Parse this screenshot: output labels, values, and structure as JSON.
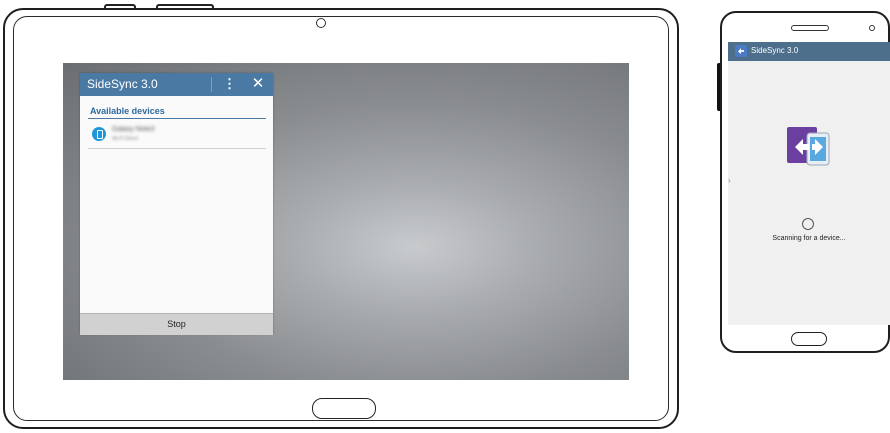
{
  "tablet": {
    "popup": {
      "title": "SideSync 3.0",
      "menu_icon": "overflow-menu-icon",
      "menu_glyph": "⋮",
      "close_icon": "close-icon",
      "close_glyph": "✕",
      "section_label": "Available devices",
      "devices": [
        {
          "name": "Galaxy Note3",
          "subtitle": "Wi-Fi Direct",
          "icon": "phone-device-icon"
        }
      ],
      "stop_label": "Stop"
    }
  },
  "phone": {
    "header_title": "SideSync 3.0",
    "app_icon": "sidesync-app-icon",
    "logo_icon": "sidesync-logo-icon",
    "status_text": "Scanning for a device...",
    "spinner_icon": "loading-spinner-icon",
    "handle_glyph": "›"
  },
  "colors": {
    "popup_header": "#4a7aa4",
    "section_label": "#2f6a9c",
    "device_icon": "#1e96d8",
    "phone_header": "#4d6f8c"
  }
}
